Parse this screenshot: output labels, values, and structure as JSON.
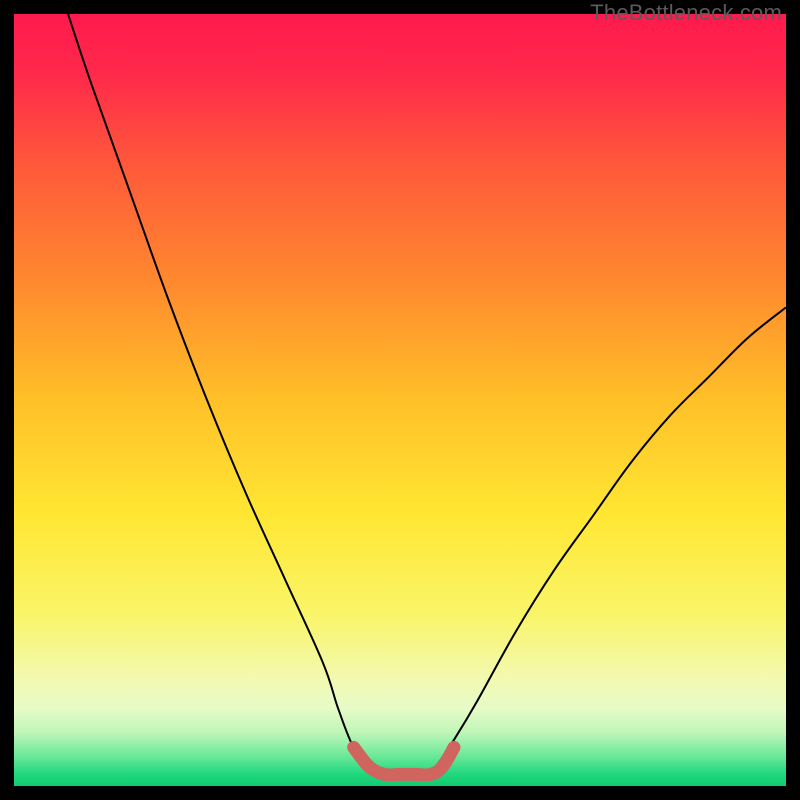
{
  "watermark": "TheBottleneck.com",
  "chart_data": {
    "type": "line",
    "title": "",
    "xlabel": "",
    "ylabel": "",
    "xlim": [
      0,
      100
    ],
    "ylim": [
      0,
      100
    ],
    "grid": false,
    "series": [
      {
        "name": "left-curve",
        "x": [
          7,
          10,
          15,
          20,
          25,
          30,
          35,
          40,
          42,
          44,
          46
        ],
        "y": [
          100,
          91,
          77,
          63,
          50,
          38,
          27,
          16,
          10,
          5,
          3
        ]
      },
      {
        "name": "right-curve",
        "x": [
          55,
          57,
          60,
          65,
          70,
          75,
          80,
          85,
          90,
          95,
          100
        ],
        "y": [
          3,
          6,
          11,
          20,
          28,
          35,
          42,
          48,
          53,
          58,
          62
        ]
      },
      {
        "name": "bottom-highlight",
        "x": [
          44,
          46,
          48,
          50,
          52,
          54,
          55.5,
          57
        ],
        "y": [
          5,
          2.5,
          1.5,
          1.5,
          1.5,
          1.5,
          2.5,
          5
        ]
      }
    ],
    "background_gradient": {
      "stops": [
        {
          "offset": 0.0,
          "color": "#ff1a4d"
        },
        {
          "offset": 0.08,
          "color": "#ff2a4a"
        },
        {
          "offset": 0.2,
          "color": "#ff5a3a"
        },
        {
          "offset": 0.35,
          "color": "#ff8a2e"
        },
        {
          "offset": 0.5,
          "color": "#ffc028"
        },
        {
          "offset": 0.65,
          "color": "#ffe733"
        },
        {
          "offset": 0.78,
          "color": "#f9f56a"
        },
        {
          "offset": 0.86,
          "color": "#f3f9b0"
        },
        {
          "offset": 0.9,
          "color": "#e6fbc8"
        },
        {
          "offset": 0.93,
          "color": "#c1f6b8"
        },
        {
          "offset": 0.96,
          "color": "#6ee99a"
        },
        {
          "offset": 0.985,
          "color": "#1fd87e"
        },
        {
          "offset": 1.0,
          "color": "#12c96f"
        }
      ]
    },
    "highlight_color": "#d0645f",
    "curve_color": "#000000"
  }
}
